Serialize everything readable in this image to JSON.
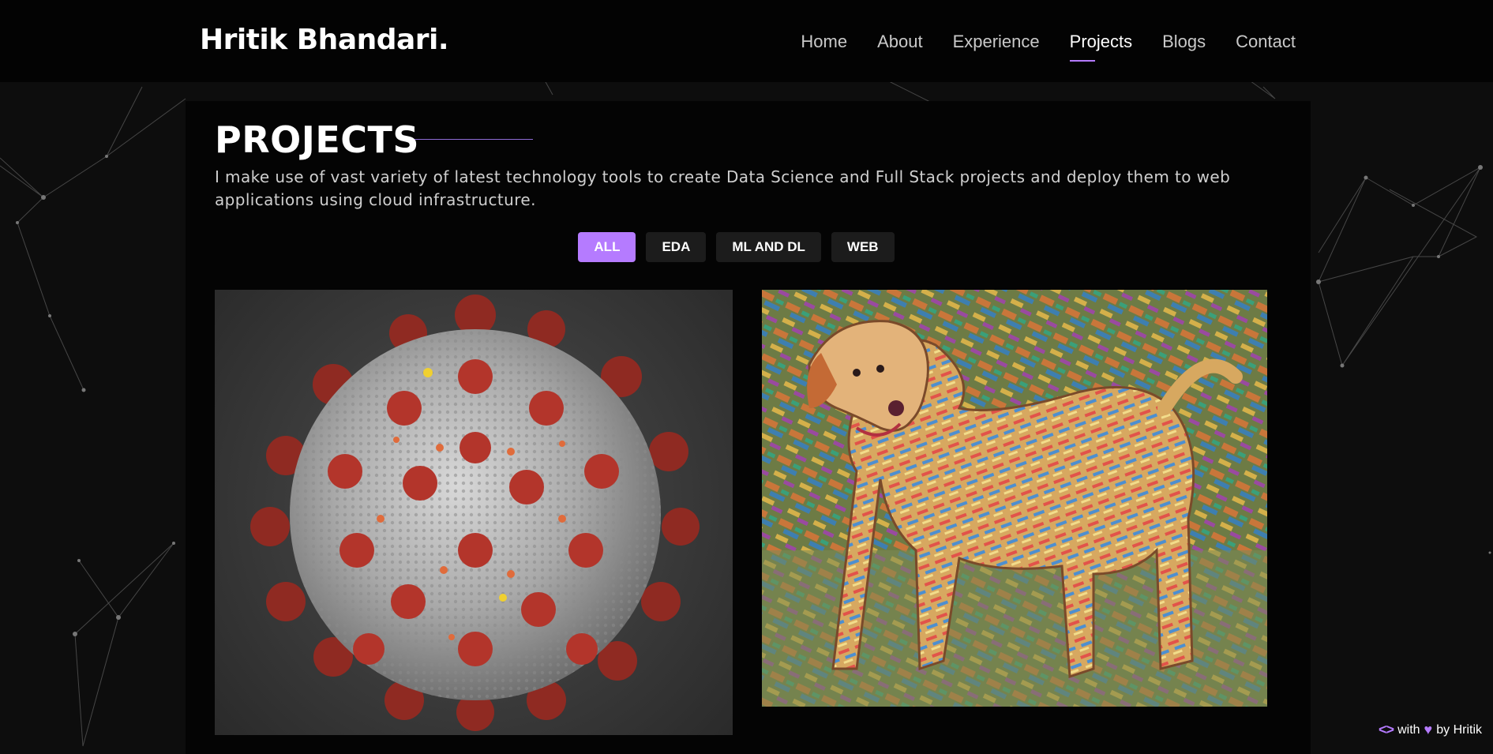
{
  "header": {
    "brand": "Hritik Bhandari.",
    "nav": [
      {
        "label": "Home"
      },
      {
        "label": "About"
      },
      {
        "label": "Experience"
      },
      {
        "label": "Projects"
      },
      {
        "label": "Blogs"
      },
      {
        "label": "Contact"
      }
    ],
    "active_nav": "Projects"
  },
  "projects_section": {
    "title": "PROJECTS",
    "intro": "I make use of vast variety of latest technology tools to create Data Science and Full Stack projects and deploy them to web applications using cloud infrastructure.",
    "filters": [
      {
        "label": "ALL"
      },
      {
        "label": "EDA"
      },
      {
        "label": "ML AND DL"
      },
      {
        "label": "WEB"
      }
    ],
    "active_filter": "ALL",
    "cards": [
      {
        "image": "coronavirus-render"
      },
      {
        "image": "style-transfer-dog"
      }
    ]
  },
  "footer": {
    "credit_with": "with",
    "credit_by": "by Hritik",
    "code_icon_glyph": "<>",
    "heart_glyph": "♥"
  },
  "theme": {
    "accent": "#b57bff",
    "background": "#0d0d0d",
    "panel": "#040404"
  }
}
